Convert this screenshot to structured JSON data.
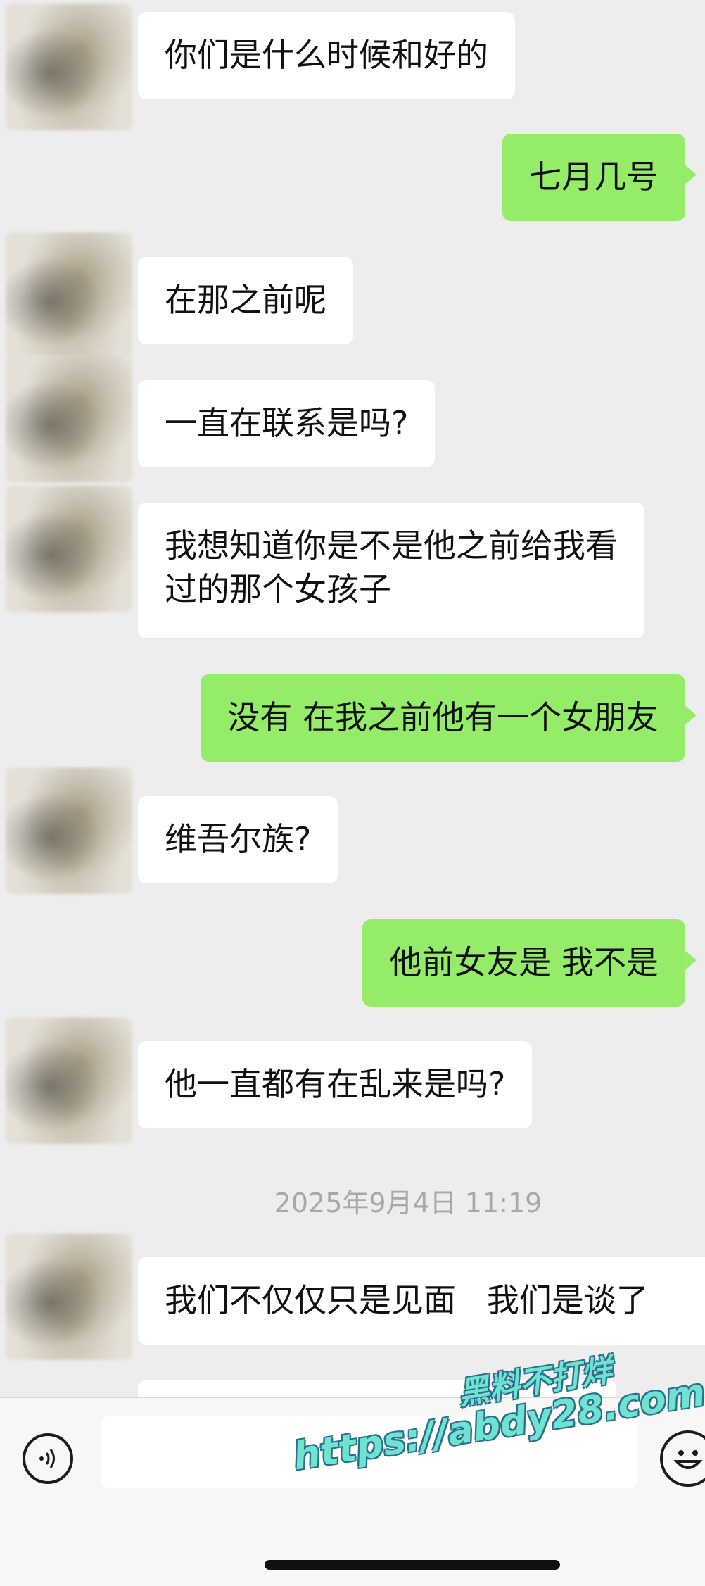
{
  "messages": [
    {
      "side": "left",
      "text": "你们是什么时候和好的"
    },
    {
      "side": "right",
      "text": "七月几号"
    },
    {
      "side": "left",
      "text": "在那之前呢"
    },
    {
      "side": "left",
      "text": "一直在联系是吗?"
    },
    {
      "side": "left",
      "text": "我想知道你是不是他之前给我看\n过的那个女孩子"
    },
    {
      "side": "right",
      "text": "没有 在我之前他有一个女朋友"
    },
    {
      "side": "left",
      "text": "维吾尔族?"
    },
    {
      "side": "right",
      "text": "他前女友是 我不是"
    },
    {
      "side": "left",
      "text": "他一直都有在乱来是吗?"
    },
    {
      "side": "left",
      "text": "我们不仅仅只是见面   我们是谈了"
    }
  ],
  "timestamp": "2025年9月4日 11:19",
  "input": {
    "value": "",
    "voice_icon": "voice-icon",
    "emoji_icon": "emoji-icon"
  },
  "watermark": {
    "title": "黑料不打烊",
    "url": "https://abdy28.com"
  },
  "colors": {
    "background": "#ededed",
    "sent_bubble": "#95ec69",
    "received_bubble": "#ffffff",
    "watermark": "#6fe3d0"
  }
}
